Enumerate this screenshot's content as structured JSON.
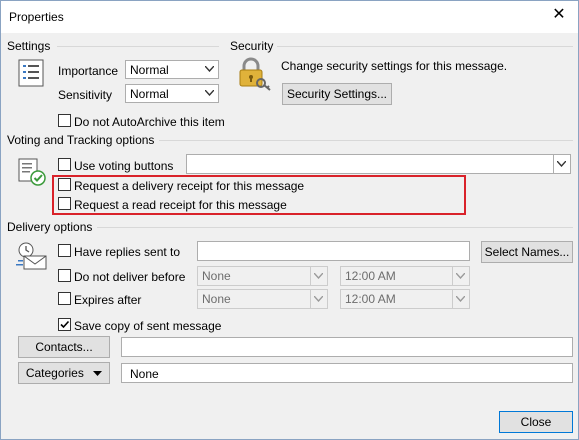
{
  "window": {
    "title": "Properties",
    "close_glyph": "✕"
  },
  "settings": {
    "section_title": "Settings",
    "importance_label": "Importance",
    "importance_value": "Normal",
    "sensitivity_label": "Sensitivity",
    "sensitivity_value": "Normal",
    "autoarchive_label": "Do not AutoArchive this item",
    "autoarchive_checked": false
  },
  "security": {
    "section_title": "Security",
    "description": "Change security settings for this message.",
    "button_label": "Security Settings..."
  },
  "voting": {
    "section_title": "Voting and Tracking options",
    "use_voting_label": "Use voting buttons",
    "use_voting_checked": false,
    "voting_value": "",
    "delivery_receipt_label": "Request a delivery receipt for this message",
    "delivery_receipt_checked": false,
    "read_receipt_label": "Request a read receipt for this message",
    "read_receipt_checked": false,
    "highlight_color": "#d9222a"
  },
  "delivery": {
    "section_title": "Delivery options",
    "replies_label": "Have replies sent to",
    "replies_value": "",
    "select_names_label": "Select Names...",
    "do_not_deliver_label": "Do not deliver before",
    "do_not_deliver_date": "None",
    "do_not_deliver_time": "12:00 AM",
    "expires_label": "Expires after",
    "expires_date": "None",
    "expires_time": "12:00 AM",
    "save_copy_label": "Save copy of sent message",
    "save_copy_checked": true
  },
  "contacts": {
    "button_label": "Contacts...",
    "value": ""
  },
  "categories": {
    "button_label": "Categories",
    "value": "None"
  },
  "footer": {
    "close_label": "Close"
  },
  "colors": {
    "accent": "#0078d7",
    "button_face": "#e1e1e1",
    "dialog_bg": "#f0f0f0"
  }
}
